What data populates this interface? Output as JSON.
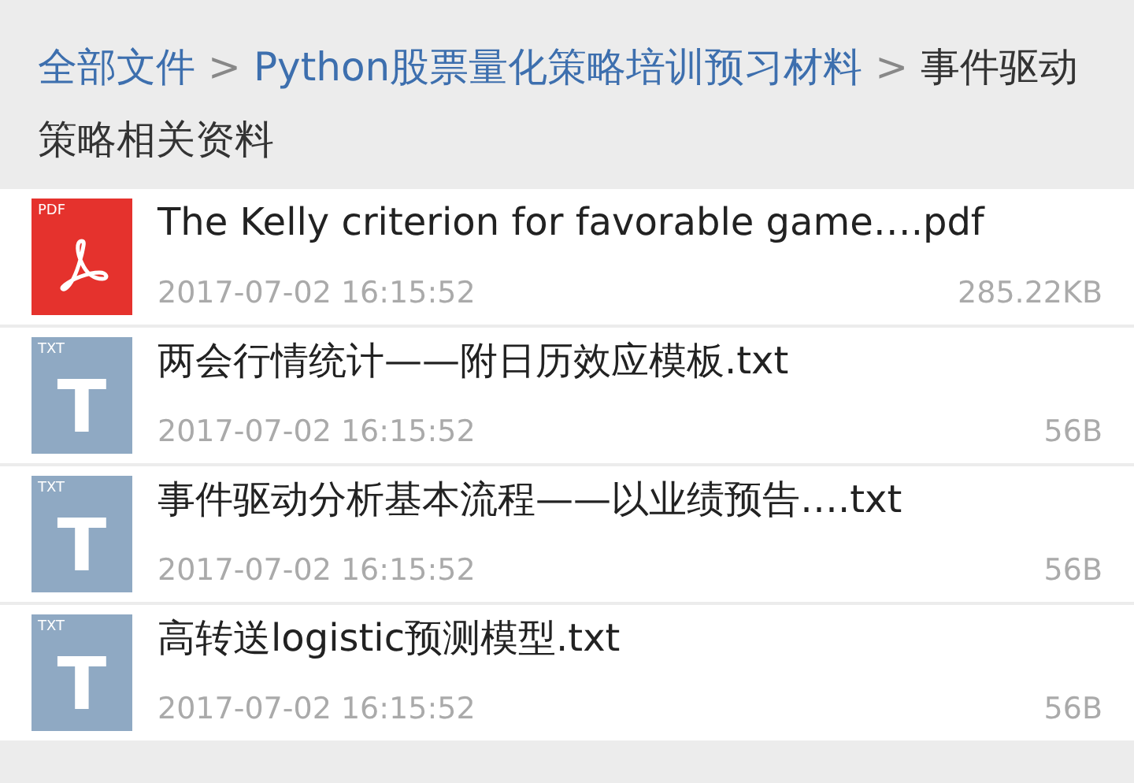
{
  "breadcrumb": [
    {
      "kind": "link",
      "label": "全部文件"
    },
    {
      "kind": "separator",
      "label": ">"
    },
    {
      "kind": "link",
      "label": "Python股票量化策略培训预习材料"
    },
    {
      "kind": "separator",
      "label": ">"
    },
    {
      "kind": "current",
      "label": "事件驱动策略相关资料"
    }
  ],
  "files": [
    {
      "kind": "pdf",
      "badge": "PDF",
      "name": "The Kelly criterion for favorable game….pdf",
      "date": "2017-07-02 16:15:52",
      "size": "285.22KB"
    },
    {
      "kind": "txt",
      "badge": "TXT",
      "glyph": "T",
      "name": "两会行情统计——附日历效应模板.txt",
      "date": "2017-07-02 16:15:52",
      "size": "56B"
    },
    {
      "kind": "txt",
      "badge": "TXT",
      "glyph": "T",
      "name": "事件驱动分析基本流程——以业绩预告….txt",
      "date": "2017-07-02 16:15:52",
      "size": "56B"
    },
    {
      "kind": "txt",
      "badge": "TXT",
      "glyph": "T",
      "name": "高转送logistic预测模型.txt",
      "date": "2017-07-02 16:15:52",
      "size": "56B"
    }
  ]
}
